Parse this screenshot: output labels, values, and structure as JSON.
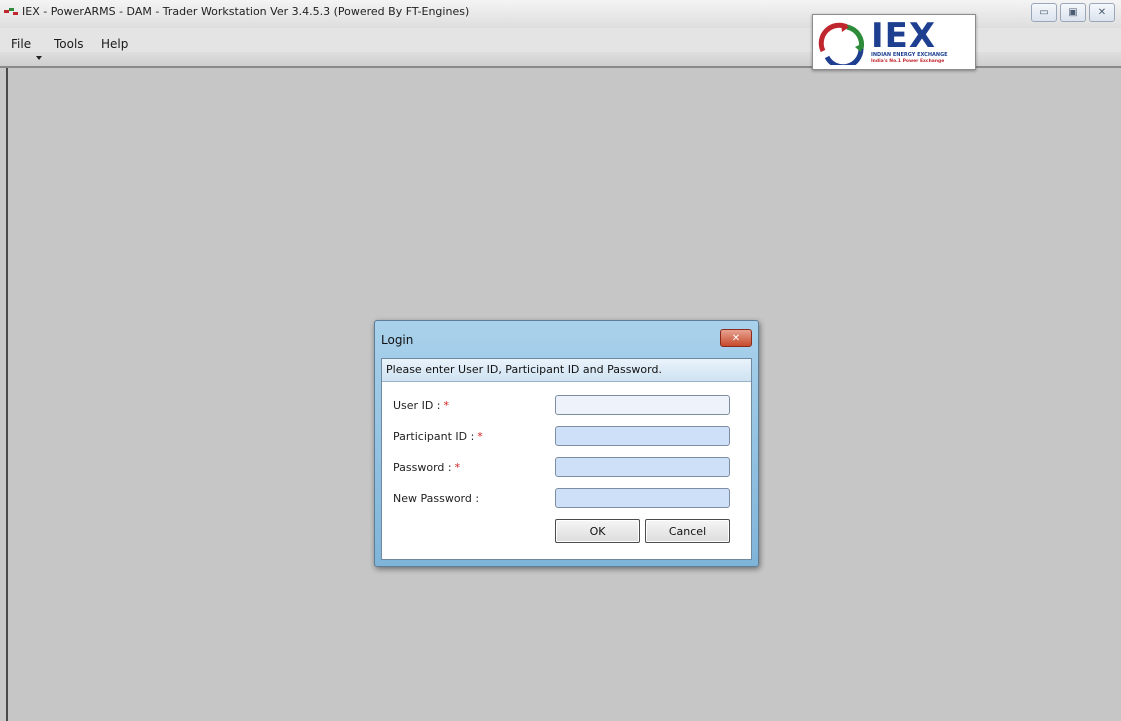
{
  "window": {
    "title": "IEX - PowerARMS - DAM - Trader Workstation Ver 3.4.5.3 (Powered By FT-Engines)",
    "controls": {
      "minimize": "▭",
      "maximize": "▣",
      "close": "✕"
    }
  },
  "menu": {
    "items": [
      "File",
      "Tools",
      "Help"
    ]
  },
  "logo": {
    "wordmark": "IEX",
    "tagline_1": "INDIAN ENERGY EXCHANGE",
    "tagline_2": "India's No.1 Power Exchange",
    "colors": {
      "blue": "#1e3f8f",
      "red": "#c0262d",
      "green": "#2e8b3a"
    }
  },
  "login_dialog": {
    "title": "Login",
    "close_glyph": "✕",
    "instruction": "Please enter User ID, Participant ID and Password.",
    "fields": [
      {
        "label": "User ID :",
        "required": true,
        "value": ""
      },
      {
        "label": "Participant ID :",
        "required": true,
        "value": ""
      },
      {
        "label": "Password :",
        "required": true,
        "value": ""
      },
      {
        "label": "New Password :",
        "required": false,
        "value": ""
      }
    ],
    "required_marker": "*",
    "ok_label": "OK",
    "cancel_label": "Cancel"
  },
  "colors": {
    "dialog_frame": "#7fb4d9",
    "input_fill": "#cde0f7",
    "required_marker": "#d21e1e",
    "workspace": "#c6c6c6"
  }
}
